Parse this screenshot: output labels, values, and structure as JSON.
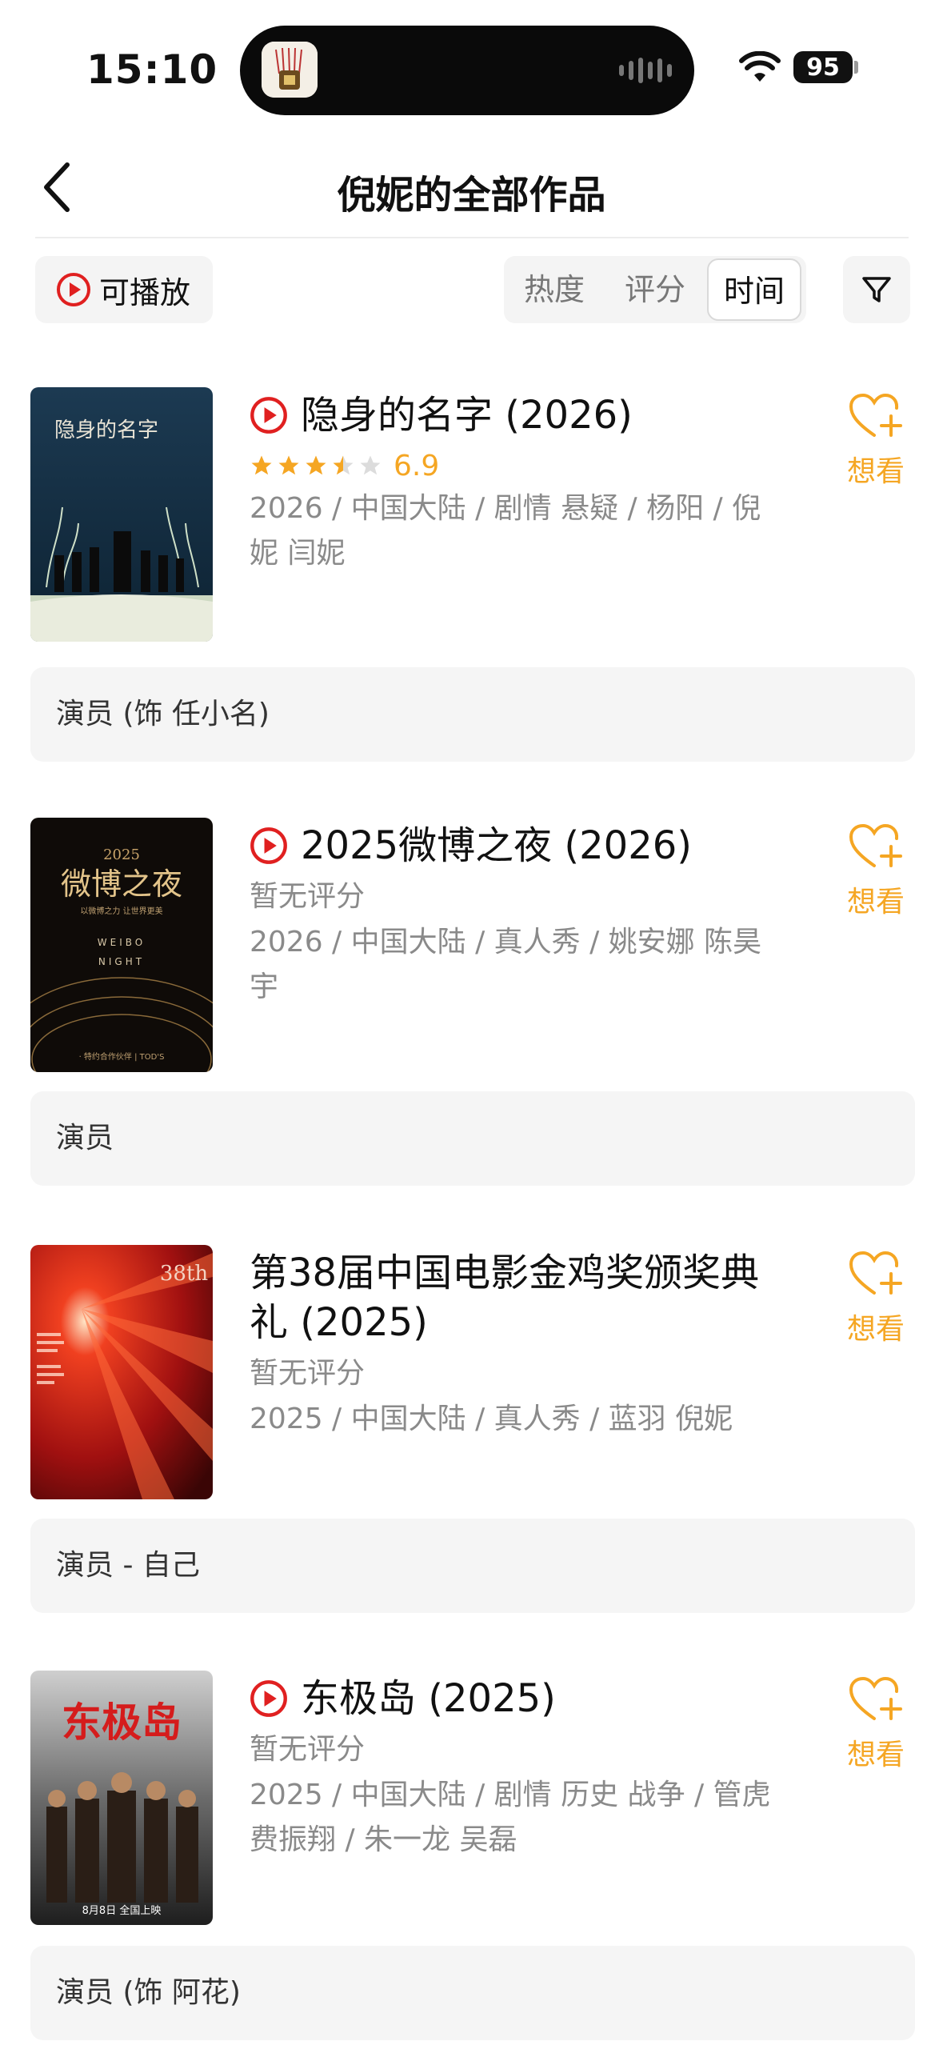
{
  "status_bar": {
    "time": "15:10",
    "battery": "95"
  },
  "nav": {
    "title": "倪妮的全部作品"
  },
  "toolbar": {
    "playable_label": "可播放",
    "sort_options": [
      "热度",
      "评分",
      "时间"
    ],
    "active_sort": "时间"
  },
  "want_label": "想看",
  "colors": {
    "accent": "#f5a623",
    "play_red": "#e02020",
    "meta_gray": "#8a8a8a"
  },
  "items": [
    {
      "playable": true,
      "title": "隐身的名字 (2026)",
      "rating": 6.9,
      "rating_text": "6.9",
      "stars": 3.5,
      "meta": "2026 / 中国大陆 / 剧情 悬疑 / 杨阳 / 倪妮 闫妮",
      "role": "演员 (饰 任小名)",
      "poster_text": "隐身的名字"
    },
    {
      "playable": true,
      "title": "2025微博之夜 (2026)",
      "rating_text": "暂无评分",
      "meta": "2026 / 中国大陆 / 真人秀 / 姚安娜 陈昊宇",
      "role": "演员",
      "poster_text": "微博之夜",
      "poster_year": "2025",
      "poster_sub": "以微博之力 让世界更美",
      "poster_en1": "WEIBO",
      "poster_en2": "NIGHT",
      "poster_sponsor": "· 特约合作伙伴 | TOD'S"
    },
    {
      "playable": false,
      "title": "第38届中国电影金鸡奖颁奖典礼 (2025)",
      "rating_text": "暂无评分",
      "meta": "2025 / 中国大陆 / 真人秀 / 蓝羽 倪妮",
      "role": "演员 - 自己",
      "poster_text": "38th"
    },
    {
      "playable": true,
      "title": "东极岛 (2025)",
      "rating_text": "暂无评分",
      "meta": "2025 / 中国大陆 / 剧情 历史 战争 / 管虎 费振翔 / 朱一龙 吴磊",
      "role": "演员 (饰 阿花)",
      "poster_text": "东极岛",
      "poster_date": "8月8日 全国上映"
    }
  ]
}
